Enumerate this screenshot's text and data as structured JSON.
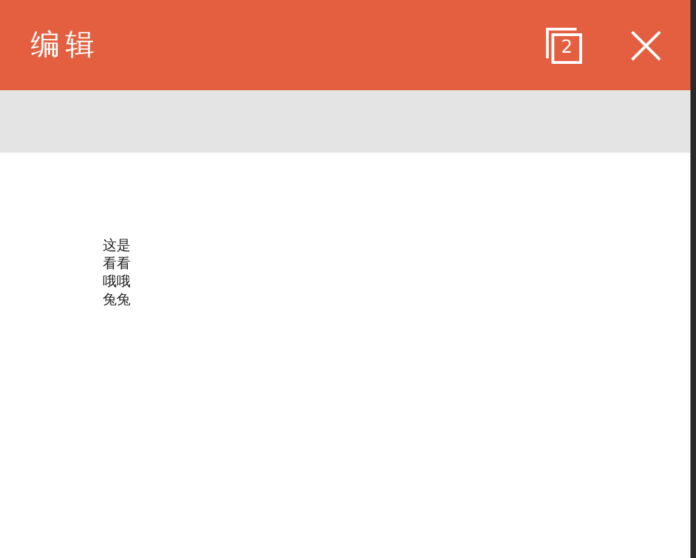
{
  "header": {
    "title": "编辑",
    "tab_count": "2"
  },
  "body": {
    "lines": [
      "这是",
      "看看",
      "哦哦",
      "兔兔"
    ]
  }
}
